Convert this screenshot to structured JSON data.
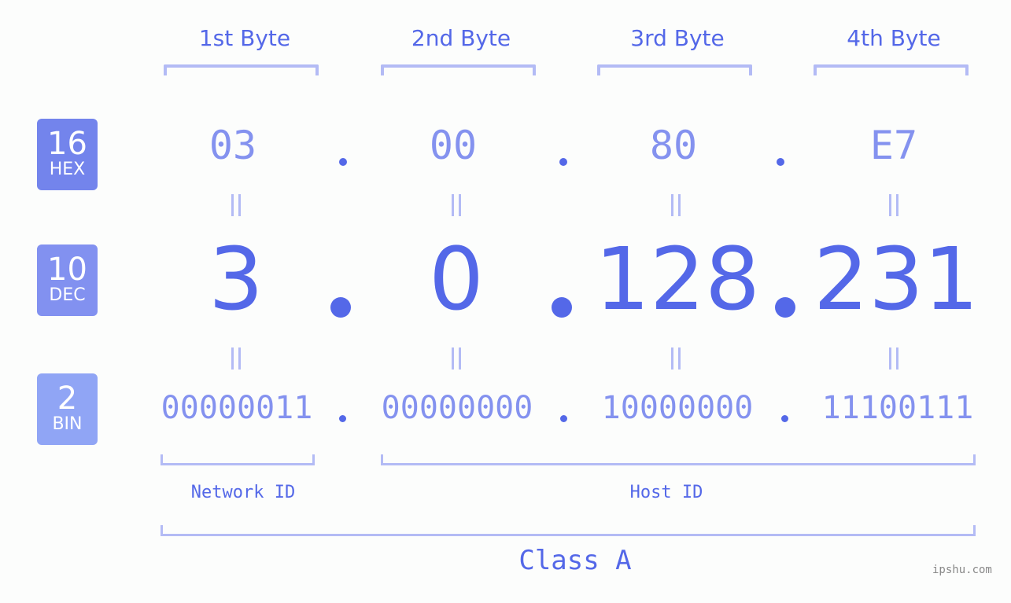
{
  "bytes": [
    {
      "label": "1st Byte",
      "hex": "03",
      "dec": "3",
      "bin": "00000011"
    },
    {
      "label": "2nd Byte",
      "hex": "00",
      "dec": "0",
      "bin": "00000000"
    },
    {
      "label": "3rd Byte",
      "hex": "80",
      "dec": "128",
      "bin": "10000000"
    },
    {
      "label": "4th Byte",
      "hex": "E7",
      "dec": "231",
      "bin": "11100111"
    }
  ],
  "badges": {
    "hex": {
      "num": "16",
      "label": "HEX",
      "color": "#7384ec"
    },
    "dec": {
      "num": "10",
      "label": "DEC",
      "color": "#8291f0"
    },
    "bin": {
      "num": "2",
      "label": "BIN",
      "color": "#90a5f5"
    }
  },
  "sections": {
    "network": "Network ID",
    "host": "Host ID",
    "class": "Class A"
  },
  "watermark": "ipshu.com",
  "colors": {
    "accent": "#5468e8",
    "light_accent": "#8492ef",
    "bracket": "#b3bbf5",
    "background": "#fcfdfc"
  }
}
